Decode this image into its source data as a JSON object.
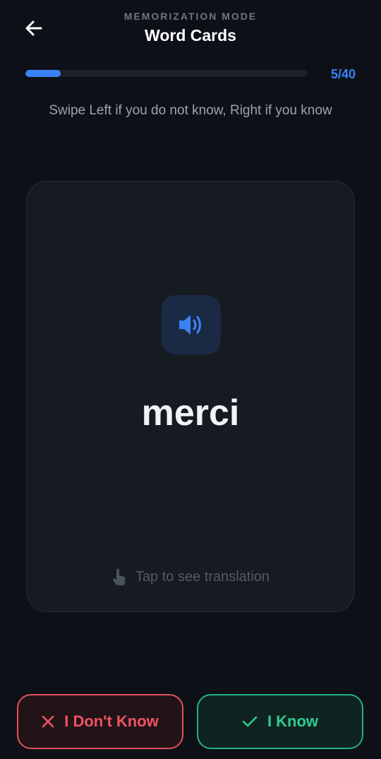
{
  "header": {
    "mode_label": "MEMORIZATION MODE",
    "title": "Word Cards"
  },
  "progress": {
    "current": 5,
    "total": 40,
    "label": "5/40"
  },
  "instructions": "Swipe Left if you do not know, Right if you know",
  "card": {
    "word": "merci",
    "hint": "Tap to see translation"
  },
  "actions": {
    "dont_know_label": "I Don't Know",
    "know_label": "I Know"
  },
  "colors": {
    "accent": "#3b82f6",
    "danger": "#ef5363",
    "success": "#2ecc8f",
    "background": "#0d1117"
  },
  "icons": {
    "back": "arrow-left-icon",
    "audio": "speaker-icon",
    "hint": "tap-hand-icon",
    "dont_know": "x-icon",
    "know": "check-icon"
  }
}
